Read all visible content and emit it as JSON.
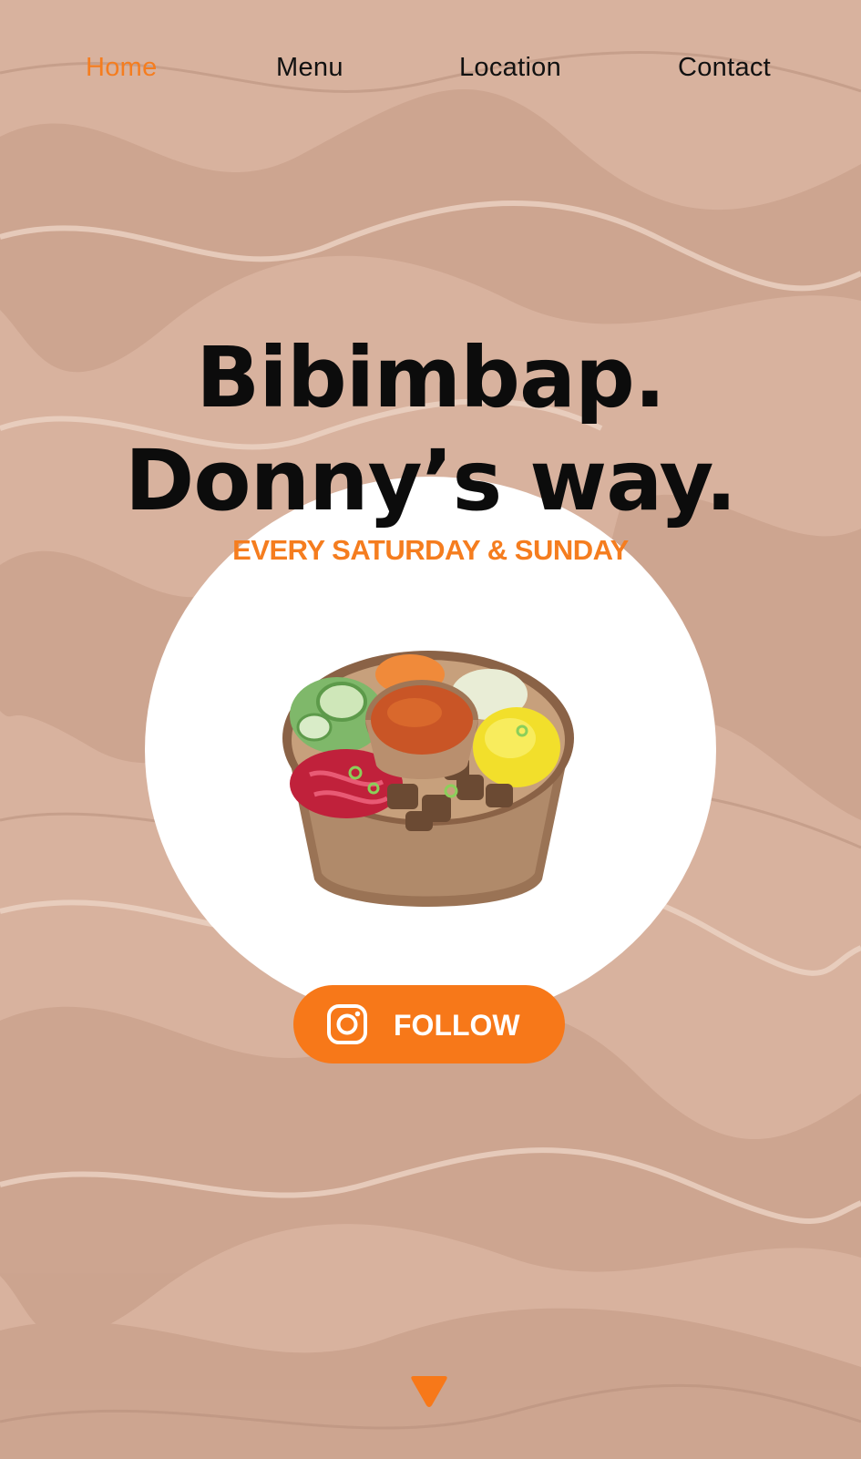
{
  "nav": {
    "items": [
      {
        "label": "Home",
        "active": true
      },
      {
        "label": "Menu",
        "active": false
      },
      {
        "label": "Location",
        "active": false
      },
      {
        "label": "Contact",
        "active": false
      }
    ]
  },
  "hero": {
    "title_line1": "Bibimbap.",
    "title_line2": "Donny’s way.",
    "subtitle": "EVERY SATURDAY & SUNDAY",
    "image_icon": "bibimbap-bowl-image"
  },
  "follow_button": {
    "label": "FOLLOW",
    "icon": "instagram-icon"
  },
  "scroll_indicator": {
    "icon": "triangle-down-icon"
  },
  "colors": {
    "accent": "#f57d1f",
    "background": "#d9b4a0",
    "text": "#0c0c0c",
    "circle": "#ffffff"
  }
}
